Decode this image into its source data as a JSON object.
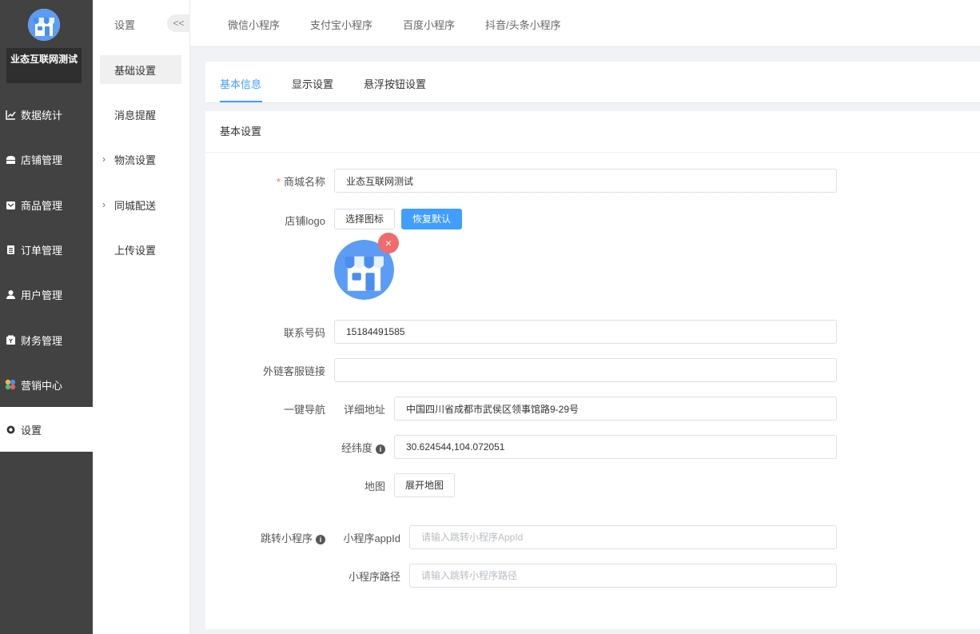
{
  "sidebar": {
    "brand": "业态互联网测试",
    "items": [
      {
        "label": "数据统计",
        "icon": "chart-icon"
      },
      {
        "label": "店铺管理",
        "icon": "shop-icon"
      },
      {
        "label": "商品管理",
        "icon": "goods-icon"
      },
      {
        "label": "订单管理",
        "icon": "order-icon"
      },
      {
        "label": "用户管理",
        "icon": "user-icon"
      },
      {
        "label": "财务管理",
        "icon": "finance-icon"
      },
      {
        "label": "营销中心",
        "icon": "marketing-icon"
      },
      {
        "label": "设置",
        "icon": "gear-icon",
        "active": true
      }
    ]
  },
  "subbar": {
    "title": "设置",
    "collapse": "<<",
    "items": [
      {
        "label": "基础设置",
        "active": true
      },
      {
        "label": "消息提醒"
      },
      {
        "label": "物流设置",
        "expandable": true
      },
      {
        "label": "同城配送",
        "expandable": true
      },
      {
        "label": "上传设置"
      }
    ]
  },
  "top_tabs": [
    "微信小程序",
    "支付宝小程序",
    "百度小程序",
    "抖音/头条小程序"
  ],
  "inner_tabs": [
    {
      "label": "基本信息",
      "active": true
    },
    {
      "label": "显示设置"
    },
    {
      "label": "悬浮按钮设置"
    }
  ],
  "section_title": "基本设置",
  "form": {
    "mall_name_label": "商城名称",
    "mall_name_value": "业态互联网测试",
    "logo_label": "店铺logo",
    "choose_icon": "选择图标",
    "restore_default": "恢复默认",
    "phone_label": "联系号码",
    "phone_value": "15184491585",
    "service_link_label": "外链客服链接",
    "service_link_value": "",
    "nav_label": "一键导航",
    "address_label": "详细地址",
    "address_value": "中国四川省成都市武侯区领事馆路9-29号",
    "latlng_label": "经纬度",
    "latlng_value": "30.624544,104.072051",
    "map_label": "地图",
    "expand_map": "展开地图",
    "jump_label": "跳转小程序",
    "appid_label": "小程序appId",
    "appid_placeholder": "请输入跳转小程序AppId",
    "path_label": "小程序路径",
    "path_placeholder": "请输入跳转小程序路径"
  },
  "colors": {
    "primary": "#409eff",
    "sidebar": "#424242",
    "danger": "#f06b6b"
  }
}
